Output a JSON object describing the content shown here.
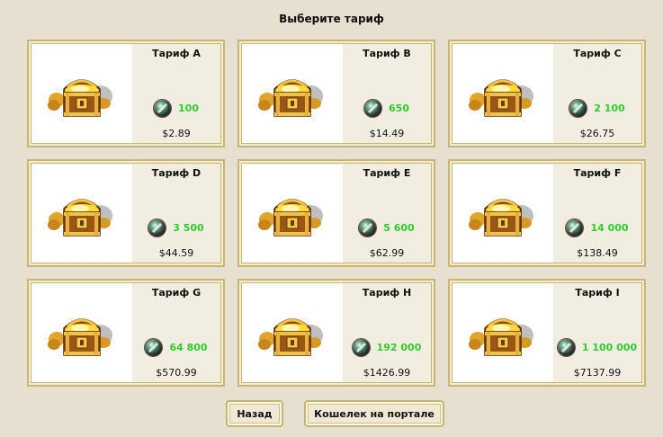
{
  "title": "Выберите тариф",
  "currency_icon": "gem-icon",
  "colors": {
    "amount": "#2fcc2a",
    "frame": "#c8b474",
    "background": "#e7dfcf"
  },
  "tariffs": [
    {
      "name": "Тариф A",
      "amount": "100",
      "price": "$2.89",
      "image": "treasure-chest-icon"
    },
    {
      "name": "Тариф B",
      "amount": "650",
      "price": "$14.49",
      "image": "treasure-chest-icon"
    },
    {
      "name": "Тариф C",
      "amount": "2 100",
      "price": "$26.75",
      "image": "treasure-chest-icon"
    },
    {
      "name": "Тариф D",
      "amount": "3 500",
      "price": "$44.59",
      "image": "treasure-chest-icon"
    },
    {
      "name": "Тариф E",
      "amount": "5 600",
      "price": "$62.99",
      "image": "treasure-chest-icon"
    },
    {
      "name": "Тариф F",
      "amount": "14 000",
      "price": "$138.49",
      "image": "treasure-chest-icon"
    },
    {
      "name": "Тариф G",
      "amount": "64 800",
      "price": "$570.99",
      "image": "treasure-chest-icon"
    },
    {
      "name": "Тариф H",
      "amount": "192 000",
      "price": "$1426.99",
      "image": "treasure-chest-icon"
    },
    {
      "name": "Тариф I",
      "amount": "1 100 000",
      "price": "$7137.99",
      "image": "treasure-chest-icon"
    }
  ],
  "buttons": {
    "back": "Назад",
    "wallet": "Кошелек на портале"
  }
}
